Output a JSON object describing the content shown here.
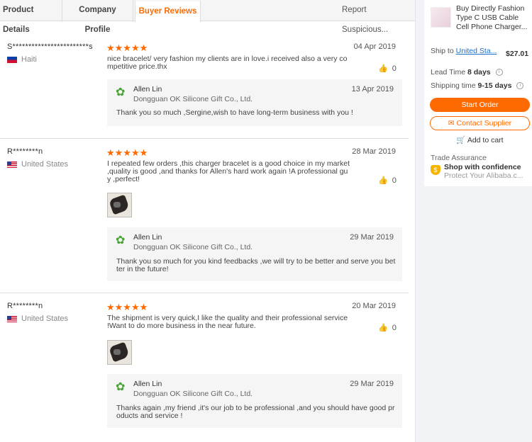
{
  "tabs": [
    {
      "label": "Product Details"
    },
    {
      "label": "Company Profile"
    },
    {
      "label": "Buyer Reviews"
    },
    {
      "label": "Report Suspicious..."
    }
  ],
  "reviews": [
    {
      "buyer": "S************************s",
      "country": "Haiti",
      "stars": "★★★★★",
      "date": "04 Apr 2019",
      "comment": "nice bracelet/ very fashion my clients are in love.i received also a very competitive price.thx",
      "likes": "0",
      "reply": {
        "name": "Allen Lin",
        "company": "Dongguan OK Silicone Gift Co., Ltd.",
        "date": "13 Apr 2019",
        "text": "Thank you so much ,Sergine,wish to have long-term business with you !"
      }
    },
    {
      "buyer": "R********n",
      "country": "United States",
      "stars": "★★★★★",
      "date": "28 Mar 2019",
      "comment": "I repeated few orders ,this charger bracelet is a good choice in my market ,quality is good ,and thanks for Allen's hard work again !A professional guy ,perfect!",
      "likes": "0",
      "reply": {
        "name": "Allen Lin",
        "company": "Dongguan OK Silicone Gift Co., Ltd.",
        "date": "29 Mar 2019",
        "text": "Thank you so much for you kind feedbacks ,we will try to be better and serve you better in the future!"
      }
    },
    {
      "buyer": "R********n",
      "country": "United States",
      "stars": "★★★★★",
      "date": "20 Mar 2019",
      "comment": "The shipment is very quick,I like the quality and their professional service !Want to do more business in the near future.",
      "likes": "0",
      "reply": {
        "name": "Allen Lin",
        "company": "Dongguan OK Silicone Gift Co., Ltd.",
        "date": "29 Mar 2019",
        "text": "Thanks again ,my friend ,it's our job to be professional ,and you should have good products and service !"
      }
    }
  ],
  "sidebar": {
    "product_title": "Buy Directly Fashion Type C USB Cable Cell Phone Charger...",
    "ship_to_label": "Ship to",
    "ship_to_value": "United Sta...",
    "price": "$27.01",
    "lead_time_label": "Lead Time",
    "lead_time_value": "8 days",
    "shipping_time_label": "Shipping time",
    "shipping_time_value": "9-15 days",
    "start_order": "Start Order",
    "contact_supplier": "Contact Supplier",
    "add_to_cart": "Add to cart",
    "trade_assurance": "Trade Assurance",
    "shop_confidence": "Shop with confidence",
    "protect": "Protect Your Alibaba.c..."
  },
  "colors": {
    "accent": "#ff6a00",
    "link": "#1a6fc9",
    "reply_bg": "#f5f5f5"
  }
}
